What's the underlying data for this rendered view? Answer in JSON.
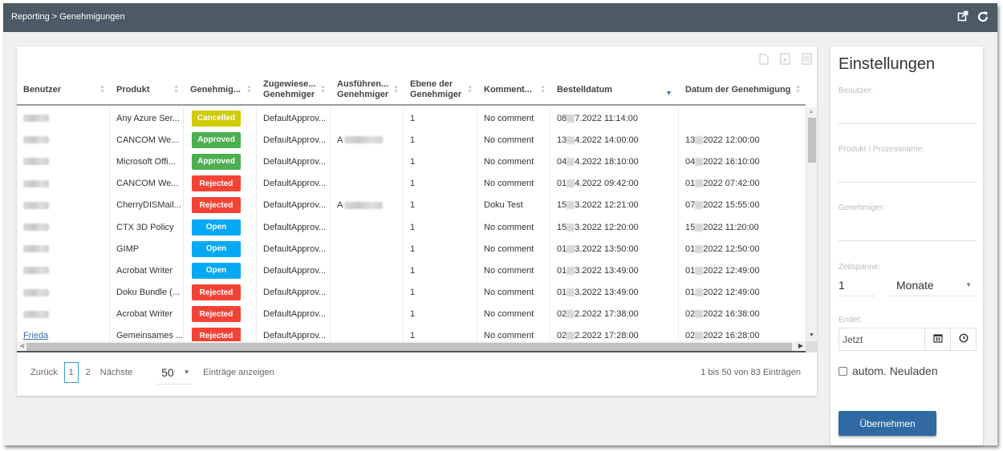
{
  "header": {
    "breadcrumb": "Reporting > Genehmigungen",
    "icons": [
      "external-link-icon",
      "refresh-icon"
    ]
  },
  "toolbar": {
    "icons": [
      "copy-icon",
      "excel-export-icon",
      "csv-export-icon"
    ]
  },
  "table": {
    "columns": [
      {
        "line1": "Benutzer",
        "line2": ""
      },
      {
        "line1": "Produkt",
        "line2": ""
      },
      {
        "line1": "Genehmig...",
        "line2": ""
      },
      {
        "line1": "Zugewiese...",
        "line2": "Genehmiger"
      },
      {
        "line1": "Ausführen...",
        "line2": "Genehmiger"
      },
      {
        "line1": "Ebene der",
        "line2": "Genehmiger"
      },
      {
        "line1": "Komment...",
        "line2": ""
      },
      {
        "line1": "Bestelldatum",
        "line2": ""
      },
      {
        "line1": "Datum der Genehmigung",
        "line2": ""
      }
    ],
    "sorted_column": "Bestelldatum",
    "sort_direction": "descending",
    "rows": [
      {
        "user": "",
        "user_blurred": true,
        "product": "Any Azure Ser...",
        "status": "Cancelled",
        "assigned": "DefaultApprov...",
        "executing": "",
        "executing_prefix": "",
        "level": "1",
        "comment": "No comment",
        "order_date_day": "08",
        "order_date_rest": "7.2022 11:14:00",
        "approval_date_day": "",
        "approval_date_rest": ""
      },
      {
        "user": "",
        "user_blurred": true,
        "product": "CANCOM We...",
        "status": "Approved",
        "assigned": "DefaultApprov...",
        "executing": "blurred",
        "executing_prefix": "A",
        "level": "1",
        "comment": "No comment",
        "order_date_day": "13",
        "order_date_rest": "4.2022 14:00:00",
        "approval_date_day": "13",
        "approval_date_rest": "2022 12:00:00"
      },
      {
        "user": "",
        "user_blurred": true,
        "product": "Microsoft Offi...",
        "status": "Approved",
        "assigned": "DefaultApprov...",
        "executing": "",
        "executing_prefix": "",
        "level": "1",
        "comment": "No comment",
        "order_date_day": "04",
        "order_date_rest": "4.2022 18:10:00",
        "approval_date_day": "04",
        "approval_date_rest": "2022 16:10:00"
      },
      {
        "user": "",
        "user_blurred": true,
        "product": "CANCOM We...",
        "status": "Rejected",
        "assigned": "DefaultApprov...",
        "executing": "",
        "executing_prefix": "",
        "level": "1",
        "comment": "No comment",
        "order_date_day": "01",
        "order_date_rest": "4.2022 09:42:00",
        "approval_date_day": "01",
        "approval_date_rest": "2022 07:42:00"
      },
      {
        "user": "",
        "user_blurred": true,
        "product": "CherryDISMail...",
        "status": "Rejected",
        "assigned": "DefaultApprov...",
        "executing": "blurred",
        "executing_prefix": "A",
        "level": "1",
        "comment": "Doku Test",
        "order_date_day": "15",
        "order_date_rest": "3.2022 12:21:00",
        "approval_date_day": "07",
        "approval_date_rest": "2022 15:55:00"
      },
      {
        "user": "",
        "user_blurred": true,
        "product": "CTX 3D Policy",
        "status": "Open",
        "assigned": "DefaultApprov...",
        "executing": "",
        "executing_prefix": "",
        "level": "1",
        "comment": "No comment",
        "order_date_day": "15",
        "order_date_rest": "3.2022 12:20:00",
        "approval_date_day": "15",
        "approval_date_rest": "2022 11:20:00"
      },
      {
        "user": "",
        "user_blurred": true,
        "product": "GIMP",
        "status": "Open",
        "assigned": "DefaultApprov...",
        "executing": "",
        "executing_prefix": "",
        "level": "1",
        "comment": "No comment",
        "order_date_day": "01",
        "order_date_rest": "3.2022 13:50:00",
        "approval_date_day": "01",
        "approval_date_rest": "2022 12:50:00"
      },
      {
        "user": "",
        "user_blurred": true,
        "product": "Acrobat Writer",
        "status": "Open",
        "assigned": "DefaultApprov...",
        "executing": "",
        "executing_prefix": "",
        "level": "1",
        "comment": "No comment",
        "order_date_day": "01",
        "order_date_rest": "3.2022 13:49:00",
        "approval_date_day": "01",
        "approval_date_rest": "2022 12:49:00"
      },
      {
        "user": "",
        "user_blurred": true,
        "product": "Doku Bundle (...",
        "status": "Rejected",
        "assigned": "DefaultApprov...",
        "executing": "",
        "executing_prefix": "",
        "level": "1",
        "comment": "No comment",
        "order_date_day": "01",
        "order_date_rest": "3.2022 13:49:00",
        "approval_date_day": "01",
        "approval_date_rest": "2022 12:49:00"
      },
      {
        "user": "",
        "user_blurred": true,
        "product": "Acrobat Writer",
        "status": "Rejected",
        "assigned": "DefaultApprov...",
        "executing": "",
        "executing_prefix": "",
        "level": "1",
        "comment": "No comment",
        "order_date_day": "02",
        "order_date_rest": "2.2022 17:38:00",
        "approval_date_day": "02",
        "approval_date_rest": "2022 16:38:00"
      },
      {
        "user": "Frieda",
        "user_blurred": false,
        "product": "Gemeinsames ...",
        "status": "Rejected",
        "assigned": "DefaultApprov...",
        "executing": "",
        "executing_prefix": "",
        "level": "1",
        "comment": "No comment",
        "order_date_day": "02",
        "order_date_rest": "2.2022 17:28:00",
        "approval_date_day": "02",
        "approval_date_rest": "2022 16:28:00"
      }
    ],
    "status_colors": {
      "Cancelled": "#cfcc00",
      "Approved": "#4caf50",
      "Rejected": "#f44336",
      "Open": "#03a9f4"
    }
  },
  "pagination": {
    "prev_label": "Zurück",
    "pages": [
      "1",
      "2"
    ],
    "current_page": "1",
    "next_label": "Nächste",
    "page_size": "50",
    "page_size_label": "Einträge anzeigen",
    "range_info": "1 bis 50 von 83 Einträgen"
  },
  "settings": {
    "title": "Einstellungen",
    "user_label": "Benutzer:",
    "user_value": "",
    "product_label": "Produkt / Prozessname:",
    "product_value": "",
    "approver_label": "Genehmiger:",
    "approver_value": "",
    "timespan_label": "Zeitspanne:",
    "timespan_value": "1",
    "timespan_unit": "Monate",
    "ends_label": "Endet:",
    "ends_value": "Jetzt",
    "auto_reload_label": "autom. Neuladen",
    "auto_reload_checked": false,
    "apply_label": "Übernehmen"
  }
}
